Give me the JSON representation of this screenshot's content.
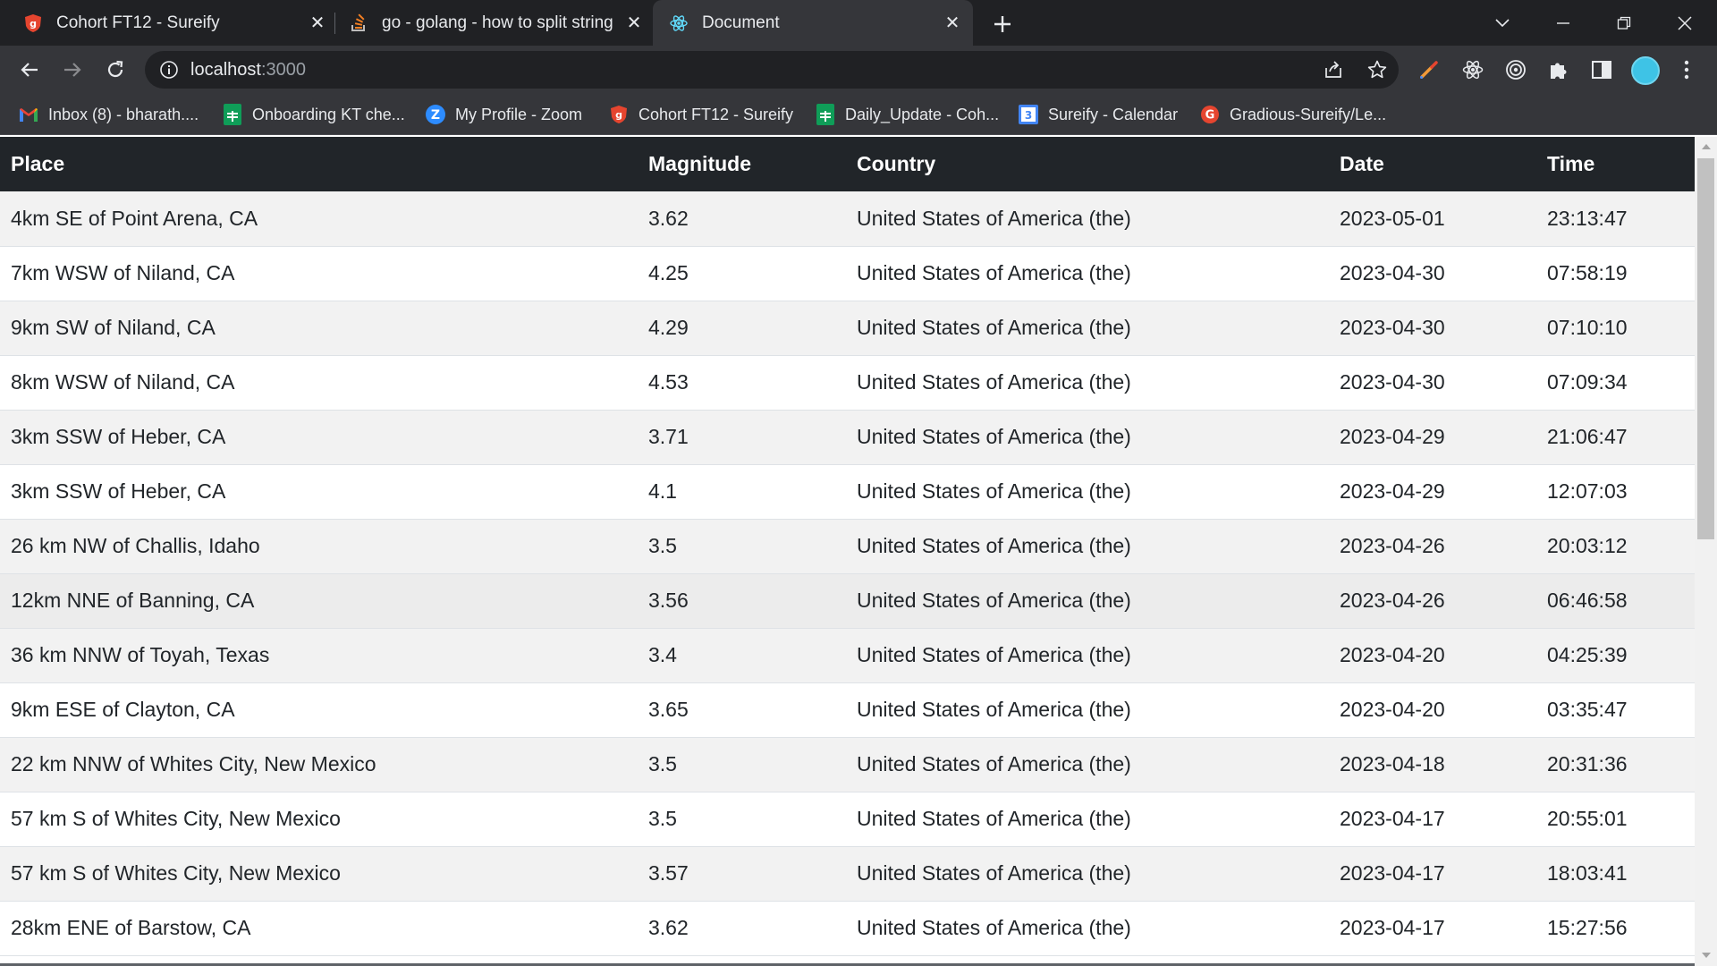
{
  "browser": {
    "tabs": [
      {
        "title": "Cohort FT12 - Sureify",
        "icon": "gradious-shield-icon",
        "active": false
      },
      {
        "title": "go - golang - how to split string",
        "icon": "stackoverflow-icon",
        "active": false
      },
      {
        "title": "Document",
        "icon": "react-atom-icon",
        "active": true
      }
    ],
    "address": {
      "host": "localhost",
      "port": ":3000"
    },
    "bookmarks": [
      {
        "label": "Inbox (8) - bharath....",
        "icon": "gmail-icon"
      },
      {
        "label": "Onboarding KT che...",
        "icon": "google-sheets-icon"
      },
      {
        "label": "My Profile - Zoom",
        "icon": "zoom-icon"
      },
      {
        "label": "Cohort FT12 - Sureify",
        "icon": "gradious-shield-icon"
      },
      {
        "label": "Daily_Update - Coh...",
        "icon": "google-sheets-icon"
      },
      {
        "label": "Sureify - Calendar",
        "icon": "google-calendar-icon"
      },
      {
        "label": "Gradious-Sureify/Le...",
        "icon": "gradious-g-icon"
      }
    ]
  },
  "table": {
    "headers": [
      "Place",
      "Magnitude",
      "Country",
      "Date",
      "Time"
    ],
    "rows": [
      [
        "4km SE of Point Arena, CA",
        "3.62",
        "United States of America (the)",
        "2023-05-01",
        "23:13:47"
      ],
      [
        "7km WSW of Niland, CA",
        "4.25",
        "United States of America (the)",
        "2023-04-30",
        "07:58:19"
      ],
      [
        "9km SW of Niland, CA",
        "4.29",
        "United States of America (the)",
        "2023-04-30",
        "07:10:10"
      ],
      [
        "8km WSW of Niland, CA",
        "4.53",
        "United States of America (the)",
        "2023-04-30",
        "07:09:34"
      ],
      [
        "3km SSW of Heber, CA",
        "3.71",
        "United States of America (the)",
        "2023-04-29",
        "21:06:47"
      ],
      [
        "3km SSW of Heber, CA",
        "4.1",
        "United States of America (the)",
        "2023-04-29",
        "12:07:03"
      ],
      [
        "26 km NW of Challis, Idaho",
        "3.5",
        "United States of America (the)",
        "2023-04-26",
        "20:03:12"
      ],
      [
        "12km NNE of Banning, CA",
        "3.56",
        "United States of America (the)",
        "2023-04-26",
        "06:46:58"
      ],
      [
        "36 km NNW of Toyah, Texas",
        "3.4",
        "United States of America (the)",
        "2023-04-20",
        "04:25:39"
      ],
      [
        "9km ESE of Clayton, CA",
        "3.65",
        "United States of America (the)",
        "2023-04-20",
        "03:35:47"
      ],
      [
        "22 km NNW of Whites City, New Mexico",
        "3.5",
        "United States of America (the)",
        "2023-04-18",
        "20:31:36"
      ],
      [
        "57 km S of Whites City, New Mexico",
        "3.5",
        "United States of America (the)",
        "2023-04-17",
        "20:55:01"
      ],
      [
        "57 km S of Whites City, New Mexico",
        "3.57",
        "United States of America (the)",
        "2023-04-17",
        "18:03:41"
      ],
      [
        "28km ENE of Barstow, CA",
        "3.62",
        "United States of America (the)",
        "2023-04-17",
        "15:27:56"
      ]
    ]
  }
}
